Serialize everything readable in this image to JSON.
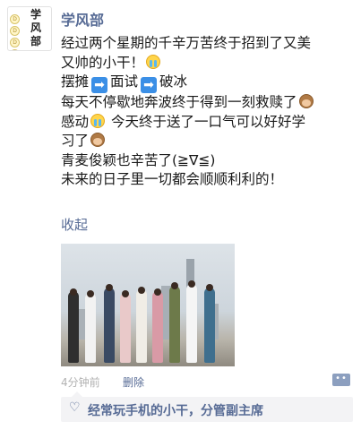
{
  "avatar": {
    "chars": [
      "学",
      "风",
      "部"
    ],
    "dot_letters": [
      "D",
      "D",
      "D",
      "D"
    ]
  },
  "post": {
    "author": "学风部",
    "line1": "经过两个星期的千辛万苦终于招到了又美",
    "line2": "又帅的小干！",
    "line3a": "摆摊",
    "line3b": "面试",
    "line3c": "破冰",
    "line4": "每天不停歇地奔波终于得到一刻救赎了",
    "line5a": "感动",
    "line5b": " 今天终于送了一口气可以好好学",
    "line6": "习了",
    "line7": "青麦俊颖也辛苦了(≧∇≦)",
    "line8": "未来的日子里一切都会顺顺利利的！",
    "collapse": "收起",
    "time": "4分钟前",
    "delete": "删除",
    "more": "••",
    "likes": "经常玩手机的小干，分管副主席"
  },
  "icons": {
    "cry": "crying-face-emoji",
    "monkey": "see-no-evil-monkey-emoji",
    "arrow": "right-arrow-emoji",
    "heart": "heart-outline-icon",
    "more": "more-comment-icon"
  },
  "colors": {
    "link": "#576b95",
    "text": "#191919",
    "meta": "#b2b2b2",
    "likes_bg": "#f3f3f5"
  }
}
